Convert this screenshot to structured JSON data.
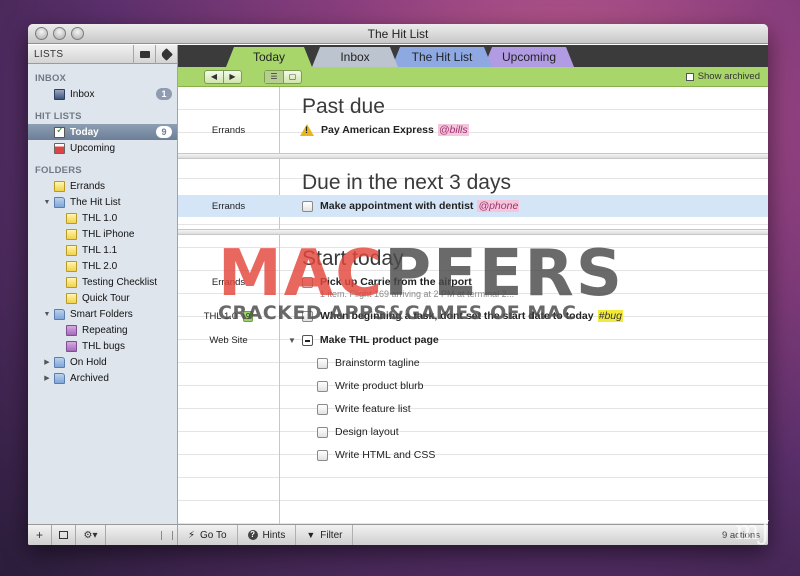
{
  "window": {
    "title": "The Hit List"
  },
  "sidebar": {
    "header": "LISTS",
    "sections": {
      "inbox": "INBOX",
      "hitlists": "HIT LISTS",
      "folders": "FOLDERS"
    },
    "inbox": {
      "label": "Inbox",
      "badge": "1"
    },
    "today": {
      "label": "Today",
      "badge": "9"
    },
    "upcoming": {
      "label": "Upcoming"
    },
    "folders": {
      "errands": "Errands",
      "hitlist": "The Hit List",
      "thl10": "THL 1.0",
      "thliphone": "THL iPhone",
      "thl11": "THL 1.1",
      "thl20": "THL 2.0",
      "testing": "Testing Checklist",
      "quicktour": "Quick Tour",
      "smart": "Smart Folders",
      "repeating": "Repeating",
      "thlbugs": "THL bugs",
      "onhold": "On Hold",
      "archived": "Archived"
    },
    "footer": {
      "add": "+",
      "gear": "⚙▾"
    }
  },
  "tabs": [
    "Today",
    "Inbox",
    "The Hit List",
    "Upcoming"
  ],
  "toolbar": {
    "show_archived": "Show archived"
  },
  "sections": {
    "past_due": "Past due",
    "due_next": "Due in the next 3 days",
    "start_today": "Start today"
  },
  "tasks": {
    "t1": {
      "folder": "Errands",
      "title": "Pay American Express",
      "tag": "@bills"
    },
    "t2": {
      "folder": "Errands",
      "title": "Make appointment with dentist",
      "tag": "@phone"
    },
    "t3": {
      "folder": "Errands",
      "title": "Pick up Carrie from the airport",
      "note": "1 item.  Flight 169 arriving at 2 PM at terminal 2..."
    },
    "t4": {
      "folder": "THL 1.0",
      "count": "9",
      "title": "When beginning a task, dont set the start date to today",
      "tag": "#bug"
    },
    "t5": {
      "folder": "Web Site",
      "title": "Make THL product page"
    },
    "subtasks": [
      "Brainstorm tagline",
      "Write product blurb",
      "Write feature list",
      "Design layout",
      "Write HTML and CSS"
    ]
  },
  "footer": {
    "goto": "Go To",
    "hints": "Hints",
    "filter": "Filter",
    "status": "9 actions"
  },
  "watermark": {
    "logo_a": "MAC",
    "logo_b": "PEERS",
    "sub": "CRACKED APPS&GAMES OF MAC",
    "corner": "mJ"
  },
  "colors": {
    "today_tab": "#a9d66a",
    "inbox_tab": "#bcc4cf",
    "hitlist_tab": "#8ea9e2",
    "upcoming_tab": "#b19be2",
    "selection": "#d4e5f8"
  }
}
